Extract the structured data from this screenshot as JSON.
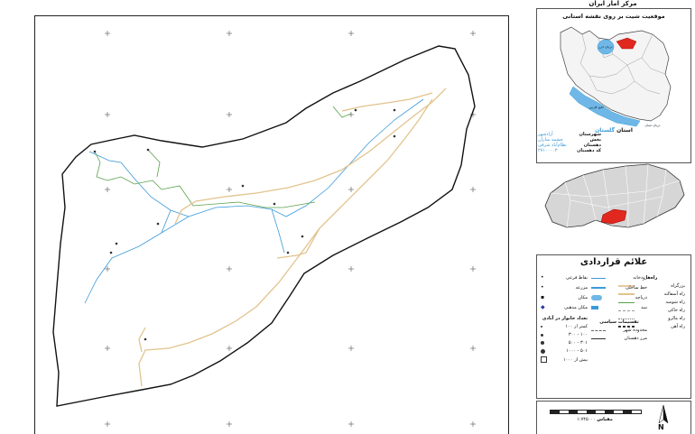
{
  "org_title": "مرکز آمار ایران",
  "location": {
    "title": "موقعیت شیت بر روی نقشه استانی",
    "province_label": "استان",
    "province_value": "گلستان",
    "caspian_label": "دریای خزر",
    "gulf_label": "خلیج فارس",
    "oman_label": "دریای عمان"
  },
  "info": {
    "rows": [
      {
        "label": "شهرستان",
        "value": "آزادشهر"
      },
      {
        "label": "بخش",
        "value": "چشمه ساران"
      },
      {
        "label": "دهستان",
        "value": "نظام‌آباد شرقی"
      },
      {
        "label": "کد دهستان",
        "value": "۲۷۱۰۰۰۰۳"
      }
    ]
  },
  "legend": {
    "title": "علائم قراردادی",
    "roads_title": "راه‌ها",
    "roads": [
      {
        "label": "بزرگراه",
        "color": "#e8c9a0"
      },
      {
        "label": "راه آسفالته",
        "color": "#e2c38d"
      },
      {
        "label": "راه شوسه",
        "color": "#5aa04a"
      },
      {
        "label": "راه خاکی",
        "color": "#999999"
      },
      {
        "label": "راه مالرو",
        "color": "#777777"
      },
      {
        "label": "راه آهن",
        "color": "#333333"
      }
    ],
    "features": [
      {
        "label": "رودخانه",
        "color": "#3a9ad9"
      },
      {
        "label": "خط ساحلی",
        "color": "#3a9ad9"
      },
      {
        "label": "دریاچه",
        "color": "#6fb7e6"
      },
      {
        "label": "سد",
        "color": "#3a9ad9"
      }
    ],
    "boundary_title": "تقسیمات سیاسی",
    "boundaries": [
      {
        "label": "محدوده شهر",
        "color": "#666666"
      },
      {
        "label": "مرز دهستان",
        "color": "#333333"
      }
    ],
    "points": [
      {
        "label": "نقاط فرعی"
      },
      {
        "label": "مزرعه"
      },
      {
        "label": "مکان"
      },
      {
        "label": "مکان مذهبی"
      }
    ],
    "households_title": "تعداد خانوار در آبادی",
    "households": [
      {
        "label": "کمتر از ۱۰۰"
      },
      {
        "label": "۱۰۰ - ۳۰۰"
      },
      {
        "label": "۳۰۱ - ۵۰۰"
      },
      {
        "label": "۵۰۱ - ۱۰۰۰"
      },
      {
        "label": "بیش از ۱۰۰۰"
      }
    ]
  },
  "scale": {
    "label": "مقیاس",
    "ratio": "۱:۷۴۵۰۰۰",
    "north": "N"
  },
  "colors": {
    "road": "#e2c38d",
    "river": "#3a9ad9",
    "green_road": "#5aa04a",
    "highlight": "#e0281e"
  }
}
